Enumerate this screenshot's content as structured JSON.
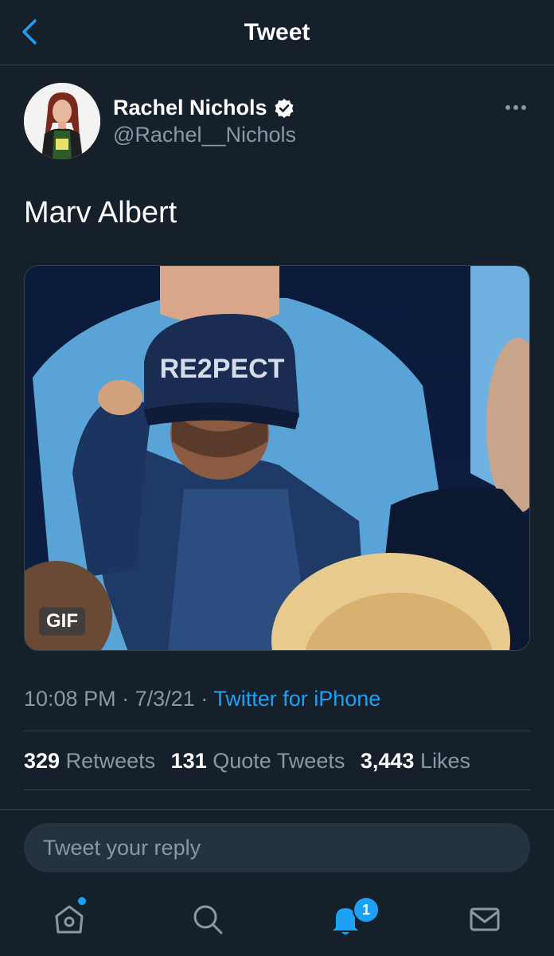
{
  "header": {
    "title": "Tweet",
    "back_icon": "chevron-left-icon"
  },
  "author": {
    "name": "Rachel Nichols",
    "handle": "@Rachel__Nichols",
    "verified": true,
    "more_icon": "more-horizontal-icon"
  },
  "tweet": {
    "text": "Marv Albert",
    "media": {
      "type": "gif",
      "badge": "GIF",
      "cap_text": "RE2PECT"
    },
    "time": "10:08 PM",
    "date": "7/3/21",
    "source": "Twitter for iPhone"
  },
  "stats": {
    "retweets_count": "329",
    "retweets_label": "Retweets",
    "quotes_count": "131",
    "quotes_label": "Quote Tweets",
    "likes_count": "3,443",
    "likes_label": "Likes"
  },
  "reply": {
    "placeholder": "Tweet your reply"
  },
  "tabbar": {
    "home_icon": "home-icon",
    "search_icon": "search-icon",
    "notifications_icon": "bell-icon",
    "notifications_badge": "1",
    "messages_icon": "mail-icon"
  },
  "colors": {
    "background": "#15202b",
    "accent": "#1da1f2",
    "secondary_text": "#8899a6",
    "divider": "#38444d"
  }
}
